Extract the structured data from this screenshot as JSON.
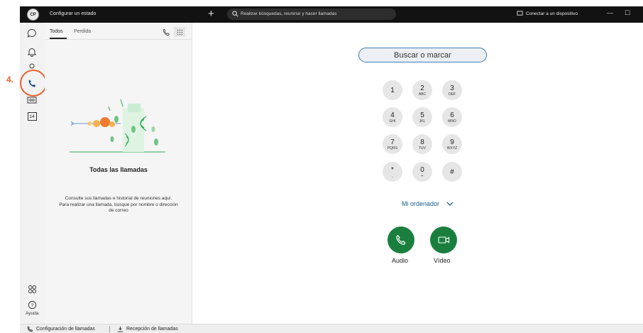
{
  "topbar": {
    "avatar_initials": "CP",
    "status_label": "Configurar un estado",
    "search_placeholder": "Realizar búsquedas, reunirse y hacer llamadas",
    "connect_label": "Conectar a un dispositivo"
  },
  "annotation": {
    "step_label": "4.",
    "color": "#e8612c"
  },
  "leftnav": {
    "items": [
      {
        "icon": "chat-icon"
      },
      {
        "icon": "bell-icon"
      },
      {
        "icon": "person-icon"
      },
      {
        "icon": "phone-icon"
      },
      {
        "icon": "voicemail-icon"
      },
      {
        "icon": "calendar-icon",
        "label": "14"
      }
    ],
    "apps_icon": "apps-icon",
    "help_label": "Ayuda"
  },
  "panel": {
    "tabs": [
      {
        "label": "Todos",
        "active": true
      },
      {
        "label": "Perdida",
        "active": false
      }
    ],
    "empty_title": "Todas las llamadas",
    "empty_desc_1": "Consulte sus llamadas e historial de reuniones aquí.",
    "empty_desc_2": "Para realizar una llamada, busque por nombre o dirección de correo"
  },
  "dialpad": {
    "search_label": "Buscar o marcar",
    "keys": [
      {
        "digit": "1",
        "letters": ""
      },
      {
        "digit": "2",
        "letters": "ABC"
      },
      {
        "digit": "3",
        "letters": "DEF"
      },
      {
        "digit": "4",
        "letters": "GHI"
      },
      {
        "digit": "5",
        "letters": "JKL"
      },
      {
        "digit": "6",
        "letters": "MNO"
      },
      {
        "digit": "7",
        "letters": "PQRS"
      },
      {
        "digit": "8",
        "letters": "TUV"
      },
      {
        "digit": "9",
        "letters": "WXYZ"
      },
      {
        "digit": "*",
        "letters": ","
      },
      {
        "digit": "0",
        "letters": "+"
      },
      {
        "digit": "#",
        "letters": ""
      }
    ],
    "device_label": "Mi ordenador",
    "audio_label": "Audio",
    "video_label": "Vídeo",
    "accent_color": "#1a7f3e"
  },
  "bottombar": {
    "call_settings_label": "Configuración de llamadas",
    "call_pickup_label": "Recepción de llamadas"
  }
}
